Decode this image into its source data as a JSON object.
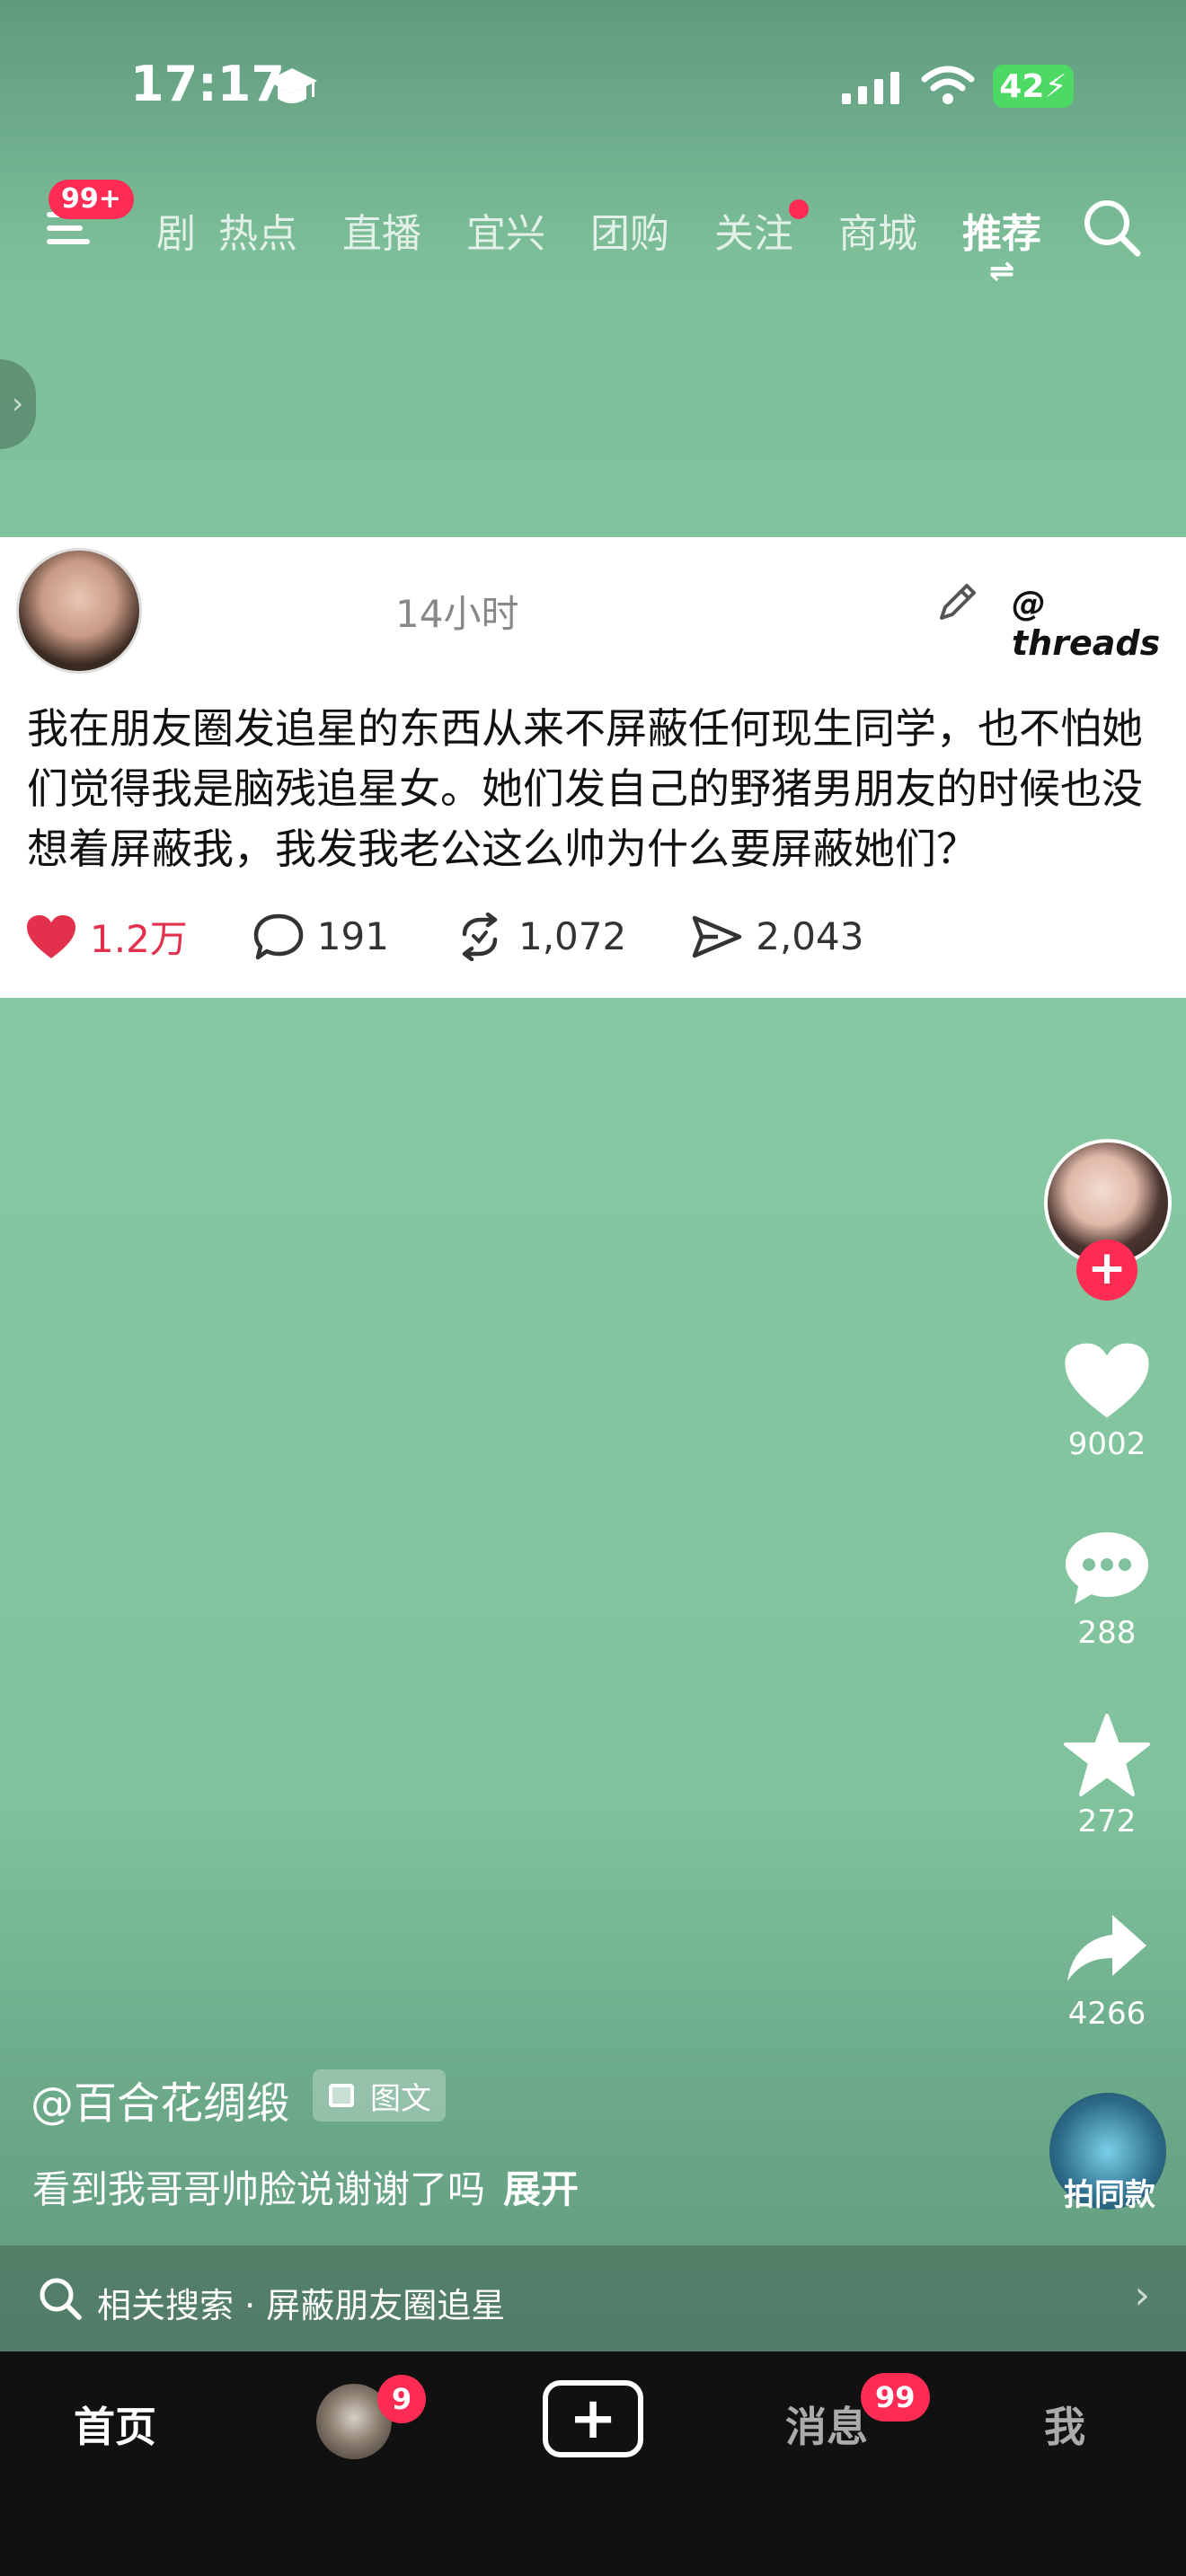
{
  "status": {
    "time": "17:17",
    "battery": "42"
  },
  "nav": {
    "menu_badge": "99+",
    "tabs": [
      {
        "label": "剧",
        "partial": true
      },
      {
        "label": "热点"
      },
      {
        "label": "直播"
      },
      {
        "label": "宜兴"
      },
      {
        "label": "团购"
      },
      {
        "label": "关注",
        "dot": true
      },
      {
        "label": "商城"
      },
      {
        "label": "推荐",
        "active": true
      }
    ],
    "switch_glyph": "⇌"
  },
  "post": {
    "time": "14小时",
    "brand": "threads",
    "text": "我在朋友圈发追星的东西从来不屏蔽任何现生同学，也不怕她们觉得我是脑残追星女。她们发自己的野猪男朋友的时候也没想着屏蔽我，我发我老公这么帅为什么要屏蔽她们？",
    "likes": "1.2万",
    "comments": "191",
    "reposts": "1,072",
    "shares": "2,043"
  },
  "rail": {
    "follow": "+",
    "like_count": "9002",
    "comment_count": "288",
    "fav_count": "272",
    "share_count": "4266",
    "same_label": "拍同款"
  },
  "caption": {
    "author": "@百合花绸缎",
    "type_badge": "图文",
    "text": "看到我哥哥帅脸说谢谢了吗",
    "expand": "展开"
  },
  "related": {
    "text": "相关搜索 · 屏蔽朋友圈追星",
    "chevron": "›"
  },
  "tabbar": {
    "home": "首页",
    "friends_badge": "9",
    "plus": "+",
    "messages": "消息",
    "messages_badge": "99",
    "me": "我"
  },
  "colors": {
    "accent": "#fe2c55",
    "like_red": "#e3304d"
  }
}
